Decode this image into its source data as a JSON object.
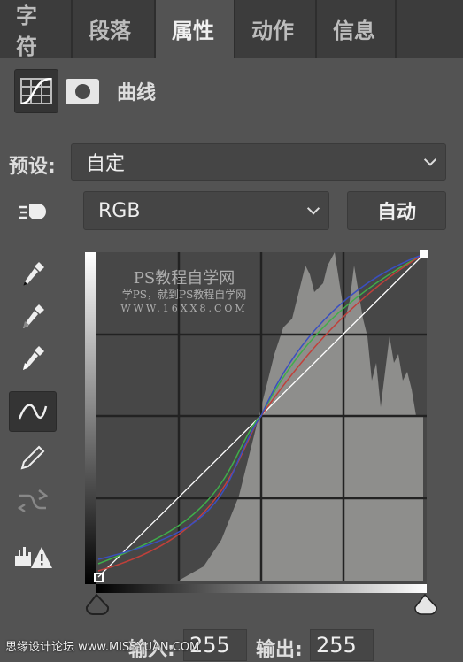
{
  "tabs": [
    {
      "label": "字符"
    },
    {
      "label": "段落"
    },
    {
      "label": "属性",
      "active": true
    },
    {
      "label": "动作"
    },
    {
      "label": "信息"
    }
  ],
  "panel": {
    "icon": "curves-adjustment-icon",
    "mask_icon": "layer-mask-icon",
    "title": "曲线"
  },
  "preset": {
    "label": "预设:",
    "value": "自定"
  },
  "channel": {
    "value": "RGB",
    "auto_label": "自动"
  },
  "tools": [
    "on-image-adjust-icon",
    "black-point-eyedropper-icon",
    "gray-point-eyedropper-icon",
    "white-point-eyedropper-icon",
    "curve-point-tool-icon",
    "pencil-icon",
    "smooth-curve-icon",
    "clipping-warning-icon"
  ],
  "watermark": {
    "title": "PS教程自学网",
    "subtitle": "学PS，就到PS教程自学网",
    "url": "WWW.16XX8.COM"
  },
  "io": {
    "input_label": "输入:",
    "input_value": "255",
    "output_label": "输出:",
    "output_value": "255"
  },
  "footer": {
    "text": "思缘设计论坛 www.MISSYUAN.COM"
  },
  "colors": {
    "red": "#c0403a",
    "green": "#3fae4a",
    "blue": "#3a4fc0",
    "white": "#ffffff"
  }
}
